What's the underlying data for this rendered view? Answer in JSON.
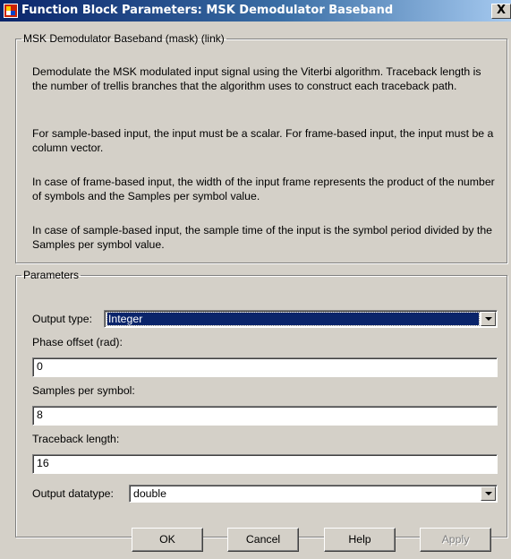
{
  "window": {
    "title": "Function Block Parameters: MSK Demodulator Baseband",
    "close_glyph": "X",
    "icon": "simulink-block-icon"
  },
  "mask": {
    "legend": "MSK Demodulator Baseband (mask) (link)",
    "paragraphs": [
      "Demodulate the MSK modulated input signal using the Viterbi algorithm. Traceback length is the number of trellis branches that the algorithm uses to construct each traceback path.",
      "For sample-based input, the input must be a scalar. For frame-based input, the input must be a column vector.",
      "In case of frame-based input, the width of the input frame represents the product of the number of symbols and the Samples per symbol value.",
      "In case of sample-based input, the sample time of the input is the symbol period divided by the Samples per symbol value."
    ]
  },
  "parameters": {
    "legend": "Parameters",
    "output_type": {
      "label": "Output type:",
      "value": "Integer"
    },
    "phase_offset": {
      "label": "Phase offset (rad):",
      "value": "0"
    },
    "samples_per_symbol": {
      "label": "Samples per symbol:",
      "value": "8"
    },
    "traceback_length": {
      "label": "Traceback length:",
      "value": "16"
    },
    "output_datatype": {
      "label": "Output datatype:",
      "value": "double"
    }
  },
  "buttons": {
    "ok": "OK",
    "cancel": "Cancel",
    "help": "Help",
    "apply": "Apply"
  }
}
